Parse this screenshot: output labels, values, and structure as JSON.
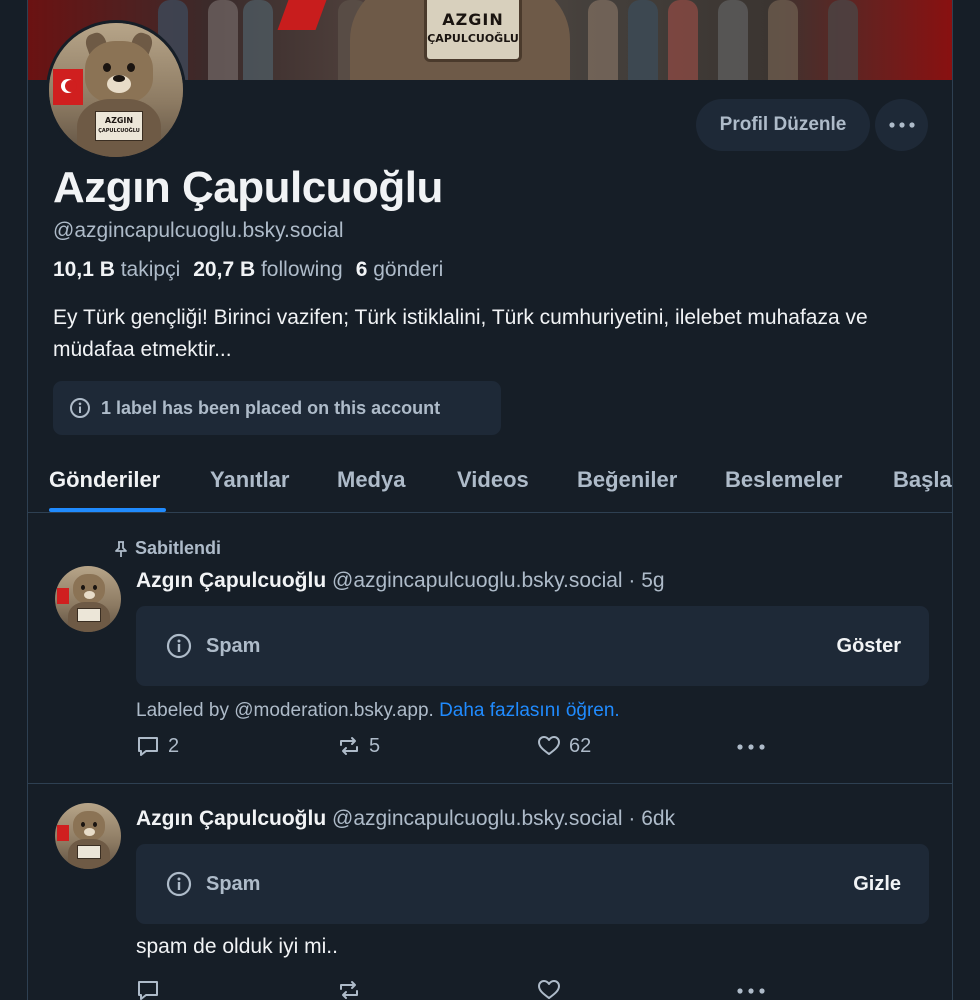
{
  "profile": {
    "banner_sign_line1": "AZGIN",
    "banner_sign_line2": "ÇAPULCUOĞLU",
    "avatar_sign_line1": "AZGIN",
    "avatar_sign_line2": "ÇAPULCUOĞLU",
    "display_name": "Azgın Çapulcuoğlu",
    "handle": "@azgincapulcuoglu.bsky.social",
    "followers_count": "10,1 B",
    "followers_label": "takipçi",
    "following_count": "20,7 B",
    "following_label": "following",
    "posts_count": "6",
    "posts_label": "gönderi",
    "bio": "Ey Türk gençliği! Birinci vazifen; Türk istiklalini, Türk cumhuriyetini, ilelebet muhafaza ve müdafaa etmektir...",
    "label_notice": "1 label has been placed on this account",
    "edit_button": "Profil Düzenle",
    "more_button": "···"
  },
  "tabs": [
    {
      "label": "Gönderiler",
      "active": true
    },
    {
      "label": "Yanıtlar",
      "active": false
    },
    {
      "label": "Medya",
      "active": false
    },
    {
      "label": "Videos",
      "active": false
    },
    {
      "label": "Beğeniler",
      "active": false
    },
    {
      "label": "Beslemeler",
      "active": false
    },
    {
      "label": "Başla",
      "active": false
    }
  ],
  "posts": [
    {
      "pinned_label": "Sabitlendi",
      "author": "Azgın Çapulcuoğlu",
      "handle": "@azgincapulcuoglu.bsky.social",
      "time": " · 5g",
      "warning_label": "Spam",
      "warning_action": "Göster",
      "labeled_by": "Labeled by @moderation.bsky.app.",
      "learn_more": "Daha fazlasını öğren.",
      "replies": "2",
      "reposts": "5",
      "likes": "62"
    },
    {
      "author": "Azgın Çapulcuoğlu",
      "handle": "@azgincapulcuoglu.bsky.social",
      "time": " · 6dk",
      "warning_label": "Spam",
      "warning_action": "Gizle",
      "text": "spam de olduk iyi mi.."
    }
  ],
  "colors": {
    "background": "#161e27",
    "surface": "#1e2937",
    "border": "#2e4052",
    "text_primary": "#f1f3f5",
    "text_secondary": "#aebbc9",
    "accent": "#208bfe"
  },
  "icons": [
    "info-icon",
    "pin-icon",
    "reply-icon",
    "repost-icon",
    "like-icon",
    "more-icon"
  ]
}
